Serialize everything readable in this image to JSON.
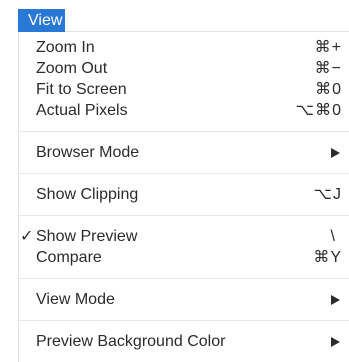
{
  "menubar": {
    "title": "View"
  },
  "menu": {
    "items": [
      {
        "label": "Zoom In",
        "shortcut": "⌘+"
      },
      {
        "label": "Zoom Out",
        "shortcut": "⌘−"
      },
      {
        "label": "Fit to Screen",
        "shortcut": "⌘0"
      },
      {
        "label": "Actual Pixels",
        "shortcut": "⌥⌘0"
      },
      {
        "label": "Browser Mode",
        "submenu_icon": "submenu-arrow-icon"
      },
      {
        "label": "Show Clipping",
        "shortcut": "⌥J"
      },
      {
        "label": "Show Preview",
        "shortcut": "\\",
        "checked": "✓"
      },
      {
        "label": "Compare",
        "shortcut": "⌘Y"
      },
      {
        "label": "View Mode",
        "submenu_icon": "submenu-arrow-icon"
      },
      {
        "label": "Preview Background Color",
        "submenu_icon": "submenu-arrow-icon"
      }
    ]
  },
  "colors": {
    "accent": "#2a78d6",
    "separator": "#e3e3e3"
  }
}
